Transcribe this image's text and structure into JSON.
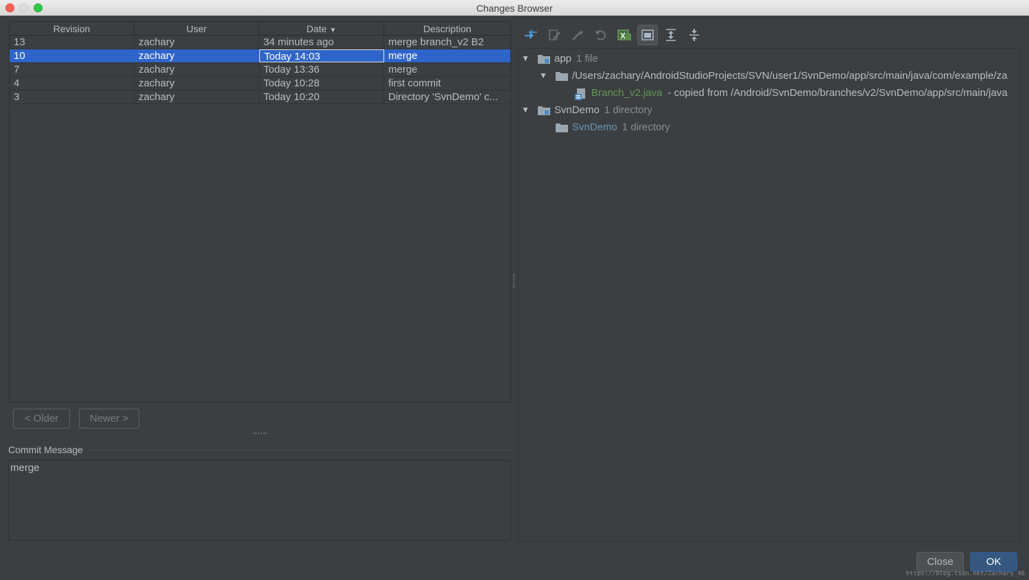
{
  "window": {
    "title": "Changes Browser"
  },
  "table": {
    "headers": {
      "revision": "Revision",
      "user": "User",
      "date": "Date",
      "description": "Description"
    },
    "rows": [
      {
        "revision": "13",
        "user": "zachary",
        "date": "34 minutes ago",
        "description": "merge branch_v2 B2"
      },
      {
        "revision": "10",
        "user": "zachary",
        "date": "Today 14:03",
        "description": "merge"
      },
      {
        "revision": "7",
        "user": "zachary",
        "date": "Today 13:36",
        "description": "merge"
      },
      {
        "revision": "4",
        "user": "zachary",
        "date": "Today 10:28",
        "description": "first commit"
      },
      {
        "revision": "3",
        "user": "zachary",
        "date": "Today 10:20",
        "description": "Directory 'SvnDemo' c..."
      }
    ],
    "selected_index": 1
  },
  "nav": {
    "older": "< Older",
    "newer": "Newer >"
  },
  "commit": {
    "label": "Commit Message",
    "text": "merge"
  },
  "tree": {
    "app_label": "app",
    "app_count": "1 file",
    "path_label": "/Users/zachary/AndroidStudioProjects/SVN/user1/SvnDemo/app/src/main/java/com/example/za",
    "file_label": "Branch_v2.java",
    "file_note": "- copied from /Android/SvnDemo/branches/v2/SvnDemo/app/src/main/java",
    "svndemo_label": "SvnDemo",
    "svndemo_count": "1 directory",
    "svndemo_child_label": "SvnDemo",
    "svndemo_child_count": "1 directory"
  },
  "buttons": {
    "close": "Close",
    "ok": "OK"
  },
  "watermark": "https://blog.csdn.net/Zachary_46",
  "colors": {
    "selection": "#2f65ca",
    "added_file": "#629755",
    "modified": "#6897bb"
  }
}
